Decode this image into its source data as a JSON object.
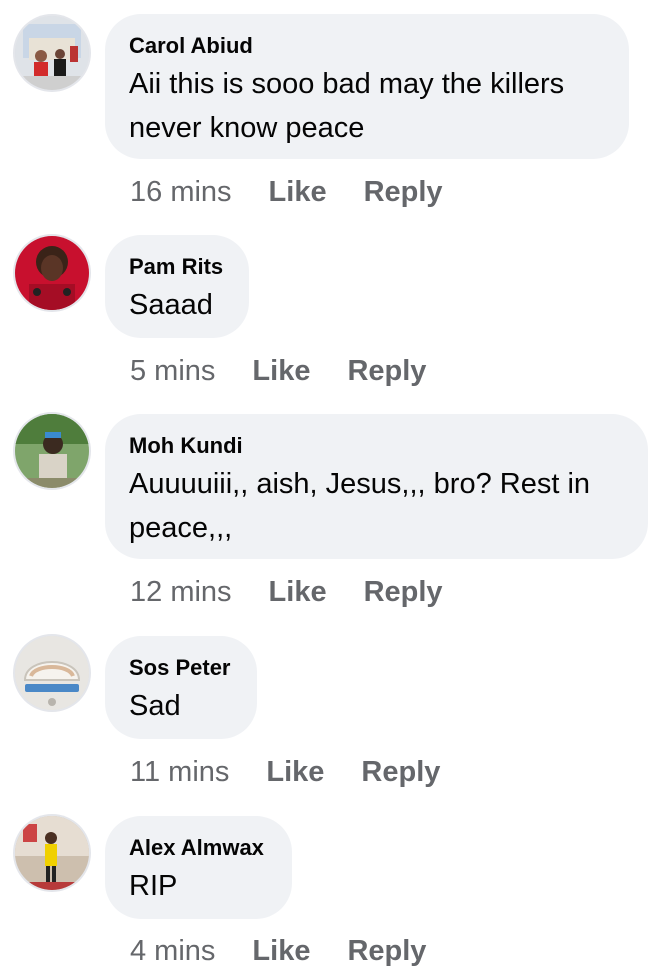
{
  "comments": [
    {
      "author": "Carol Abiud",
      "text": "Aii this is sooo bad may the killers never know peace",
      "time": "16 mins",
      "like": "Like",
      "reply": "Reply"
    },
    {
      "author": "Pam Rits",
      "text": "Saaad",
      "time": "5 mins",
      "like": "Like",
      "reply": "Reply"
    },
    {
      "author": "Moh Kundi",
      "text": "Auuuuiii,, aish, Jesus,,,  bro? Rest in peace,,,",
      "time": "12 mins",
      "like": "Like",
      "reply": "Reply"
    },
    {
      "author": "Sos Peter",
      "text": "Sad",
      "time": "11 mins",
      "like": "Like",
      "reply": "Reply"
    },
    {
      "author": "Alex Almwax",
      "text": "RIP",
      "time": "4 mins",
      "like": "Like",
      "reply": "Reply"
    }
  ]
}
